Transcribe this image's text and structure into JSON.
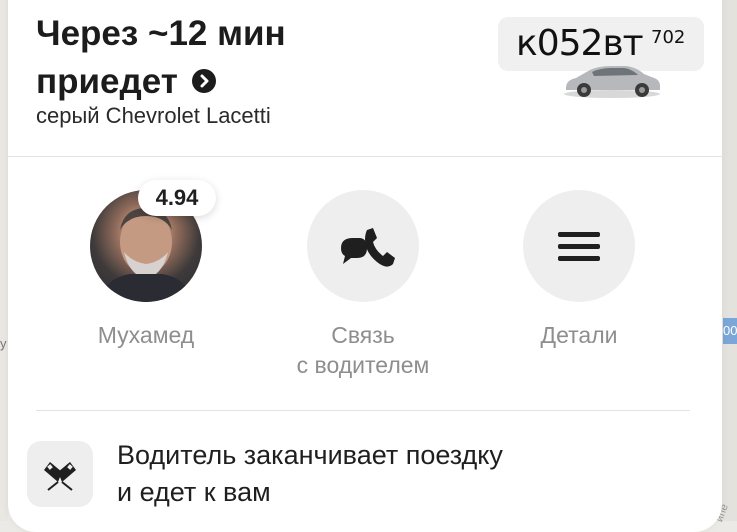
{
  "eta": {
    "line1": "Через ~12 мин",
    "line2": "приедет"
  },
  "car": {
    "model": "серый Chevrolet Lacetti",
    "plate_main": "к052вт",
    "plate_region": "702",
    "color": "#a7a9ac"
  },
  "driver": {
    "rating": "4.94",
    "name": "Мухамед"
  },
  "actions": {
    "contact_line1": "Связь",
    "contact_line2": "с водителем",
    "details": "Детали"
  },
  "status": {
    "line1": "Водитель заканчивает поездку",
    "line2": "и едет к вам"
  },
  "map": {
    "road_label": "00",
    "edge_label": "у",
    "corner_label": "ипе"
  },
  "icons": {
    "eta_arrow": "chevron-right-circle-icon",
    "contact": "phone-chat-icon",
    "details": "menu-icon",
    "status": "checkered-flags-icon"
  },
  "colors": {
    "background": "#ffffff",
    "muted_text": "#8e8e8e",
    "circle_bg": "#eeeeee"
  }
}
